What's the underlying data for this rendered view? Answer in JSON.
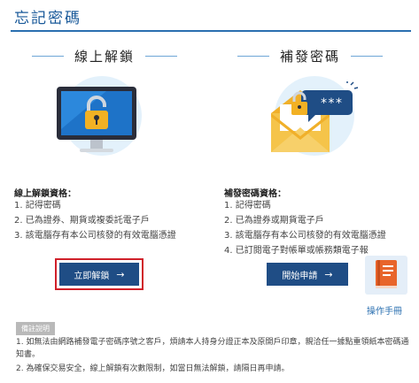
{
  "page": {
    "title": "忘記密碼"
  },
  "left": {
    "heading": "線上解鎖",
    "req_title": "線上解鎖資格：",
    "requirements": [
      "1.  記得密碼",
      "2.  已為證券、期貨或複委託電子戶",
      "3.  該電腦存有本公司核發的有效電腦憑證"
    ],
    "button_label": "立即解鎖",
    "button_arrow": "→"
  },
  "right": {
    "heading": "補發密碼",
    "req_title": "補發密碼資格：",
    "requirements": [
      "1.  記得密碼",
      "2.  已為證券或期貨電子戶",
      "3.  該電腦存有本公司核發的有效電腦憑證",
      "4.  已訂閱電子對帳單或帳務類電子報"
    ],
    "button_label": "開始申請",
    "button_arrow": "→",
    "envelope_badge": "***"
  },
  "manual": {
    "label": "操作手冊"
  },
  "notes": {
    "tag": "備註說明",
    "items": [
      "1.  如無法由網路補發電子密碼序號之客戶，煩請本人持身分證正本及原開戶印章，親洽任一據點重領紙本密碼通知書。",
      "2.  為確保交易安全，線上解鎖有次數限制，如當日無法解鎖，請隔日再申請。"
    ]
  },
  "colors": {
    "brand": "#1f4d85",
    "title": "#1a5a9a",
    "highlight": "#d0202a",
    "lock": "#f2b124"
  }
}
